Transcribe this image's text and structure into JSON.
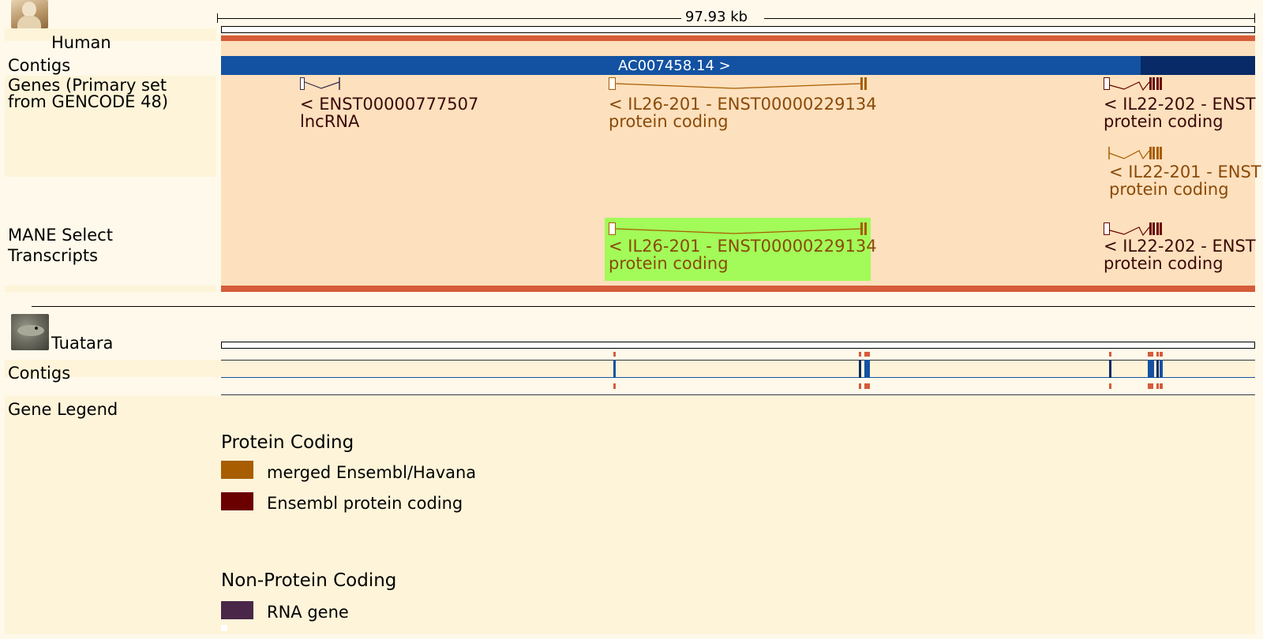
{
  "scale": {
    "label": "97.93 kb"
  },
  "human": {
    "species": "Human",
    "icon": "human-statue-icon",
    "tracks": {
      "contigs": "Contigs",
      "genes": "Genes (Primary set\nfrom GENCODE 48)",
      "mane": "MANE Select\nTranscripts"
    },
    "contig_name": "AC007458.14 >",
    "genes": [
      {
        "name": "< ENST00000777507",
        "biotype": "lncRNA"
      },
      {
        "name": "< IL26-201 - ENST00000229134",
        "biotype": "protein coding"
      },
      {
        "name": "< IL22-202 - ENST",
        "biotype": "protein coding"
      },
      {
        "name": "< IL22-201 - ENST",
        "biotype": "protein coding"
      }
    ],
    "mane": [
      {
        "name": "< IL26-201 - ENST00000229134",
        "biotype": "protein coding"
      },
      {
        "name": "< IL22-202 - ENST",
        "biotype": "protein coding"
      }
    ]
  },
  "tuatara": {
    "species": "Tuatara",
    "icon": "tuatara-icon",
    "tracks": {
      "contigs": "Contigs"
    }
  },
  "legend": {
    "title": "Gene Legend",
    "sections": [
      {
        "heading": "Protein Coding",
        "items": [
          {
            "label": "merged Ensembl/Havana",
            "color": "#a85d00"
          },
          {
            "label": "Ensembl protein coding",
            "color": "#6a0000"
          }
        ]
      },
      {
        "heading": "Non-Protein Coding",
        "items": [
          {
            "label": "RNA gene",
            "color": "#4a2748"
          }
        ]
      }
    ]
  },
  "colors": {
    "contig_blue": "#1352a2",
    "contig_dark": "#082a66",
    "highlight_orange": "#d55c3a",
    "mane_highlight": "#a2fb58",
    "track_bg": "#fde0bd",
    "page_bg": "#fef9ea"
  }
}
